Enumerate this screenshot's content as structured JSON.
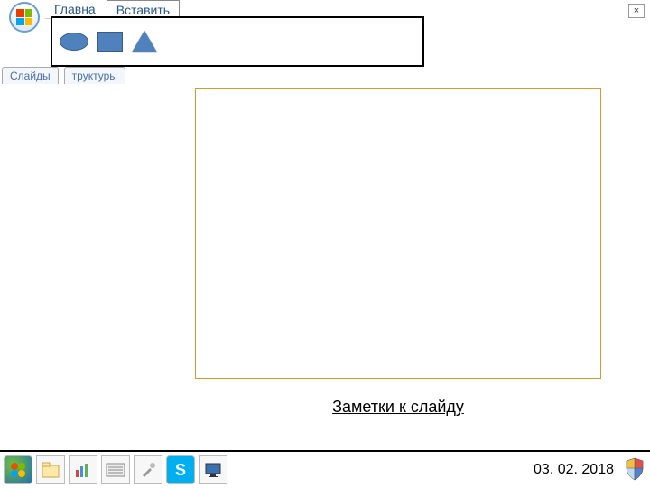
{
  "ribbon": {
    "tabs": [
      "Главна",
      "Вставить"
    ],
    "active": 1
  },
  "close_label": "×",
  "left_panel": {
    "tabs": [
      "Слайды",
      "труктуры"
    ]
  },
  "notes": {
    "placeholder": "Заметки к слайду"
  },
  "taskbar": {
    "date": "03. 02. 2018"
  },
  "icons": {
    "office": "office-logo",
    "shapes": [
      "oval",
      "rect",
      "triangle"
    ],
    "taskbar": [
      "start",
      "explorer",
      "chart",
      "keyboard",
      "tools",
      "skype",
      "monitor"
    ],
    "tray": "shield"
  }
}
